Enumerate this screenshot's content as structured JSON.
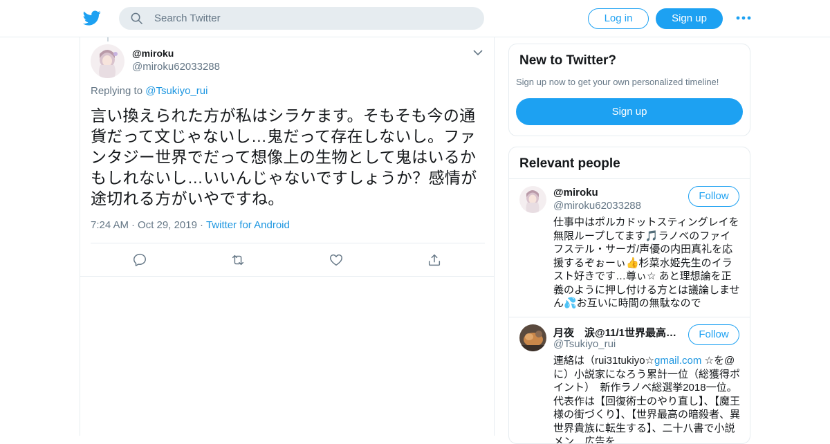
{
  "header": {
    "search_placeholder": "Search Twitter",
    "login_label": "Log in",
    "signup_label": "Sign up",
    "more_icon": "more-dots-icon"
  },
  "tweet": {
    "author_name": "@miroku",
    "author_handle": "@miroku62033288",
    "replying_prefix": "Replying to",
    "replying_to": "@Tsukiyo_rui",
    "text": "言い換えられた方が私はシラケます。そもそも今の通貨だって文じゃないし…鬼だって存在しないし。ファンタジー世界でだって想像上の生物として鬼はいるかもしれないし…いいんじゃないですしょうか？感情が途切れる方がいやですね。",
    "time": "7:24 AM",
    "date": "Oct 29, 2019",
    "source": "Twitter for Android",
    "actions": [
      "reply-icon",
      "retweet-icon",
      "like-icon",
      "share-icon"
    ]
  },
  "sidebar": {
    "new_title": "New to Twitter?",
    "new_sub": "Sign up now to get your own personalized timeline!",
    "new_button": "Sign up",
    "relevant_title": "Relevant people",
    "people": [
      {
        "name": "@miroku",
        "handle": "@miroku62033288",
        "follow": "Follow",
        "bio": "仕事中はポルカドットスティングレイを無限ループしてます🎵ラノベのファイフステル・サーガ/声優の内田真礼を応援するぞぉーぃ👍杉菜水姫先生のイラスト好きです…尊ぃ☆ あと理想論を正義のように押し付ける方とは議論しません💦お互いに時間の無駄なので"
      },
      {
        "name": "月夜　涙@11/1世界最高…",
        "handle": "@Tsukiyo_rui",
        "follow": "Follow",
        "bio_pre": "連絡は（rui31tukiyo☆",
        "bio_link": "gmail.com",
        "bio_post": " ☆を@に）小説家になろう累計一位（総獲得ポイント）　新作ラノベ総選挙2018一位。代表作は【回復術士のやり直し】、【魔王様の街づくり】、【世界最高の暗殺者、異世界貴族に転生する】、二十八書で小説メン　広告を"
      }
    ]
  },
  "colors": {
    "brand": "#1da1f2",
    "link": "#1b95e0",
    "muted": "#657786",
    "border": "#e6ecf0"
  }
}
